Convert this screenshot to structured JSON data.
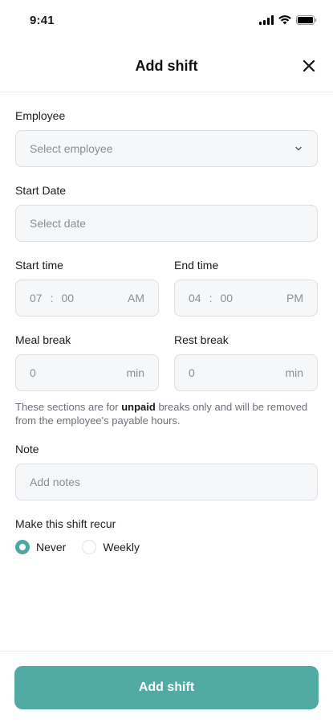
{
  "status_bar": {
    "time": "9:41"
  },
  "header": {
    "title": "Add shift",
    "close_icon": "close-icon"
  },
  "form": {
    "employee": {
      "label": "Employee",
      "placeholder": "Select employee"
    },
    "start_date": {
      "label": "Start Date",
      "placeholder": "Select date"
    },
    "start_time": {
      "label": "Start time",
      "hour": "07",
      "sep": ":",
      "minute": "00",
      "period": "AM"
    },
    "end_time": {
      "label": "End time",
      "hour": "04",
      "sep": ":",
      "minute": "00",
      "period": "PM"
    },
    "meal_break": {
      "label": "Meal break",
      "value": "0",
      "unit": "min"
    },
    "rest_break": {
      "label": "Rest break",
      "value": "0",
      "unit": "min"
    },
    "helper": {
      "before": "These sections are for ",
      "emphasis": "unpaid",
      "after": " breaks only and will be removed from the employee's payable hours."
    },
    "note": {
      "label": "Note",
      "placeholder": "Add notes"
    },
    "recur": {
      "label": "Make this shift recur",
      "options": [
        {
          "label": "Never",
          "selected": true
        },
        {
          "label": "Weekly",
          "selected": false
        }
      ]
    }
  },
  "footer": {
    "button_label": "Add shift"
  },
  "colors": {
    "accent": "#52aaa4",
    "radio_selected": "#4ea8a2"
  }
}
